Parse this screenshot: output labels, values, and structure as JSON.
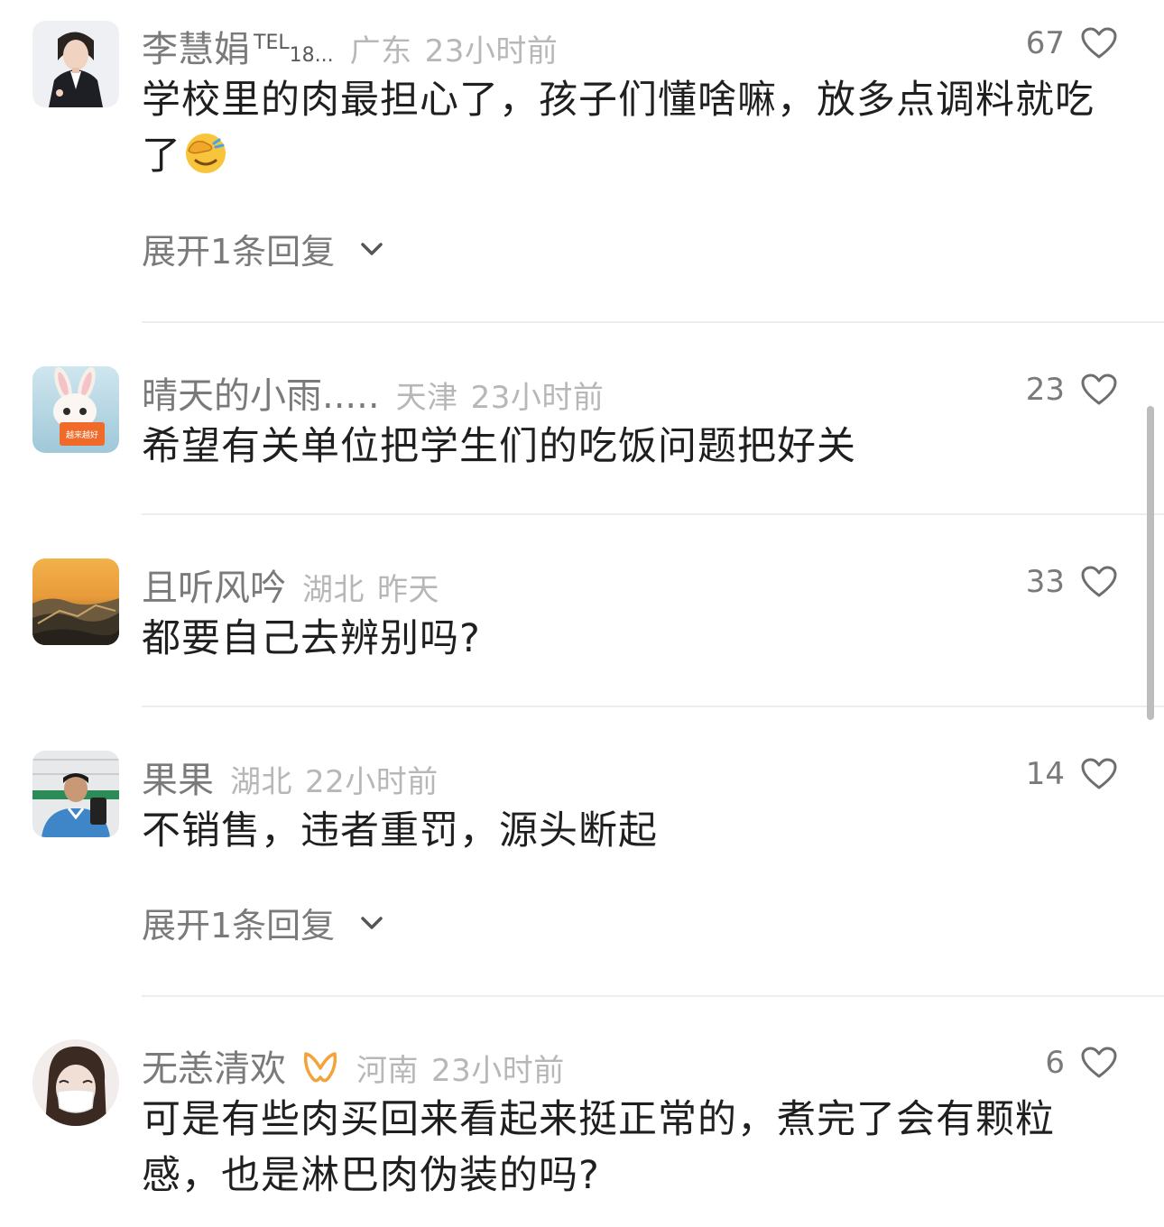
{
  "comments": [
    {
      "username": "李慧娟",
      "username_extra_sup": "TEL",
      "username_extra_sub": "18...",
      "location": "广东",
      "time": "23小时前",
      "likes": "67",
      "text": "学校里的肉最担心了，孩子们懂啥嘛，放多点调料就吃了",
      "emoji": "face-with-hand-over-eyes",
      "expand_label": "展开1条回复"
    },
    {
      "username": "晴天的小雨.....",
      "location": "天津",
      "time": "23小时前",
      "likes": "23",
      "text": "希望有关单位把学生们的吃饭问题把好关",
      "avatar_sign_text": "越来越好"
    },
    {
      "username": "且听风吟",
      "location": "湖北",
      "time": "昨天",
      "likes": "33",
      "text": "都要自己去辨别吗?"
    },
    {
      "username": "果果",
      "location": "湖北",
      "time": "22小时前",
      "likes": "14",
      "text": "不销售，违者重罚，源头断起",
      "expand_label": "展开1条回复"
    },
    {
      "username": "无恙清欢",
      "location": "河南",
      "time": "23小时前",
      "likes": "6",
      "text": "可是有些肉买回来看起来挺正常的，煮完了会有颗粒感，也是淋巴肉伪装的吗?",
      "badge": "vip-badge-icon"
    }
  ],
  "colors": {
    "username": "#7a7a7a",
    "meta": "#b7b7b7",
    "text": "#1f1f1f",
    "divider": "#ededed",
    "badge": "#f2a33a"
  }
}
